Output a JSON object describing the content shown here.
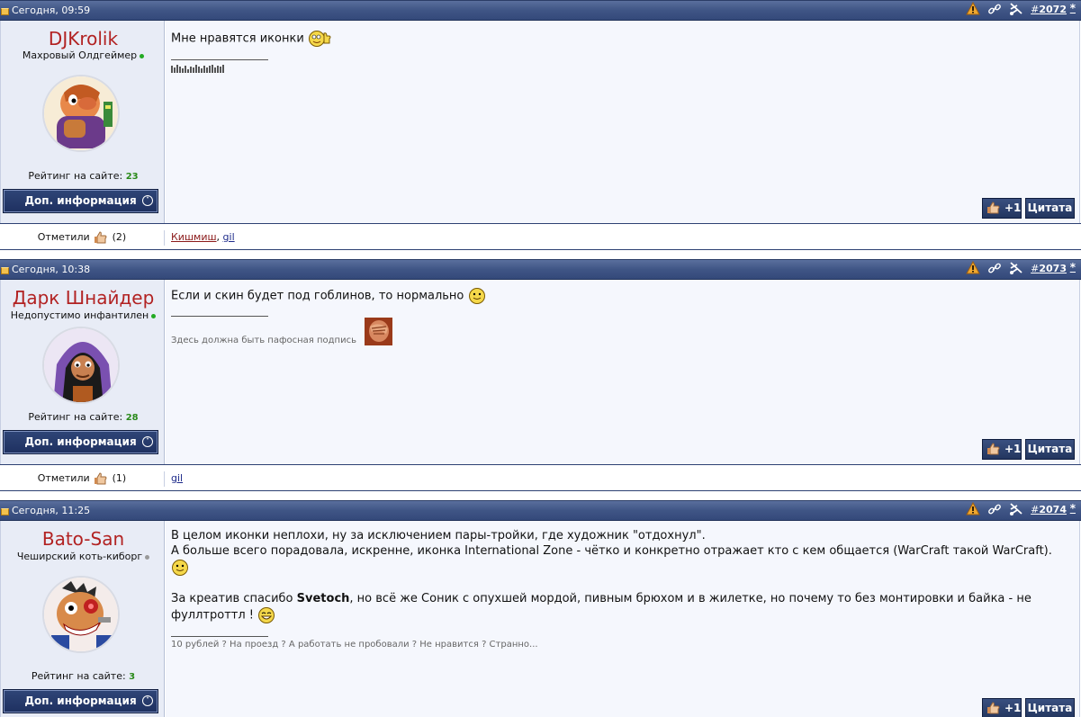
{
  "posts": [
    {
      "date": "Сегодня, 09:59",
      "number": "2072",
      "hash": "#",
      "star": "*",
      "username": "DJKrolik",
      "user_title": "Махровый Олдгеймер",
      "online": true,
      "rating_label": "Рейтинг на сайте:",
      "rating_value": "23",
      "more_label": "Доп. информация",
      "lines": [
        "Мне нравятся иконки"
      ],
      "signature": "",
      "like_label": "+1",
      "quote_label": "Цитата",
      "marks_label": "Отметили",
      "marks_count": "(2)",
      "marks_users": [
        "Кишмиш",
        "gil"
      ]
    },
    {
      "date": "Сегодня, 10:38",
      "number": "2073",
      "hash": "#",
      "star": "*",
      "username": "Дарк Шнайдер",
      "user_title": "Недопустимо инфантилен",
      "online": true,
      "rating_label": "Рейтинг на сайте:",
      "rating_value": "28",
      "more_label": "Доп. информация",
      "lines": [
        "Если и скин будет под гоблинов, то нормально"
      ],
      "signature": "Здесь должна быть пафосная подпись",
      "like_label": "+1",
      "quote_label": "Цитата",
      "marks_label": "Отметили",
      "marks_count": "(1)",
      "marks_users": [
        "gil"
      ]
    },
    {
      "date": "Сегодня, 11:25",
      "number": "2074",
      "hash": "#",
      "star": "*",
      "username": "Bato-San",
      "user_title": "Чеширский коть-киборг",
      "online": false,
      "rating_label": "Рейтинг на сайте:",
      "rating_value": "3",
      "more_label": "Доп. информация",
      "lines": [
        "В целом иконки неплохи, ну за исключением пары-тройки, где художник \"отдохнул\".",
        "А больше всего порадовала, искренне, иконка International Zone - чётко и конкретно отражает кто с кем общается (WarCraft такой WarCraft).",
        "За креатив спасибо",
        "Svetoch",
        ", но всё же Соник с опухшей мордой, пивным брюхом и в жилетке, но почему то без монтировки и байка - не",
        "фуллтроттл !"
      ],
      "signature": "10 рублей ? На проезд ? А работать не пробовали ? Не нравится ? Странно...",
      "like_label": "+1",
      "quote_label": "Цитата"
    }
  ],
  "colors": {
    "header": "#3f5585",
    "username": "#b22222",
    "rating": "#2a8a1a",
    "button": "#23365f"
  },
  "icons": [
    "warning-icon",
    "link-icon",
    "scissors-icon",
    "thumb-up-icon",
    "smiley-icon",
    "folder-icon"
  ]
}
